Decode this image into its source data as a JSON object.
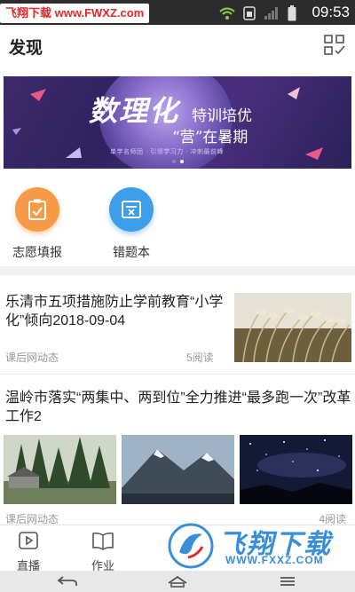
{
  "status_bar": {
    "watermark": "飞翔下载 www.FWXZ.com",
    "time": "09:53",
    "icons": [
      "wifi-icon",
      "sim-icon",
      "signal-icon",
      "battery-icon"
    ]
  },
  "header": {
    "title": "发现",
    "grid_icon": "grid-check-icon"
  },
  "banner": {
    "headline_1": "数理化",
    "headline_2": "特训培优",
    "headline_3": "“营”在暑期",
    "subline": "单学名师团 · 引领学习力 · 冲刺最前峰",
    "page_count": 2,
    "active_page": 2
  },
  "quick_actions": [
    {
      "label": "志愿填报",
      "icon": "clipboard-check-icon",
      "color": "#f69a48"
    },
    {
      "label": "错题本",
      "icon": "wrong-answer-book-icon",
      "color": "#3f9eea"
    }
  ],
  "articles": [
    {
      "title": "乐清市五项措施防止学前教育“小学化”倾向2018-09-04",
      "source": "课后网动态",
      "reads": "5阅读",
      "thumb": "reed-grass-photo"
    },
    {
      "title": "温岭市落实“两集中、两到位”全力推进“最多跑一次”改革工作2",
      "source": "课后网动态",
      "reads": "4阅读",
      "thumbs": [
        "forest-cabin-photo",
        "snowy-mountain-photo",
        "starry-sky-photo"
      ]
    }
  ],
  "tab_bar": [
    {
      "label": "直播",
      "icon": "play-square-icon"
    },
    {
      "label": "作业",
      "icon": "open-book-icon"
    },
    {
      "label": "",
      "icon": "hidden-tab-icon"
    },
    {
      "label": "",
      "icon": "hidden-tab-icon"
    },
    {
      "label": "",
      "icon": "hidden-tab-icon"
    }
  ],
  "watermark_bottom": {
    "text": "飞翔下载",
    "url": "WWW.FXXZ.COM"
  },
  "colors": {
    "orange": "#f69a48",
    "blue": "#3f9eea",
    "watermark_blue": "#3a8ed8",
    "watermark_red": "#e0282a"
  }
}
